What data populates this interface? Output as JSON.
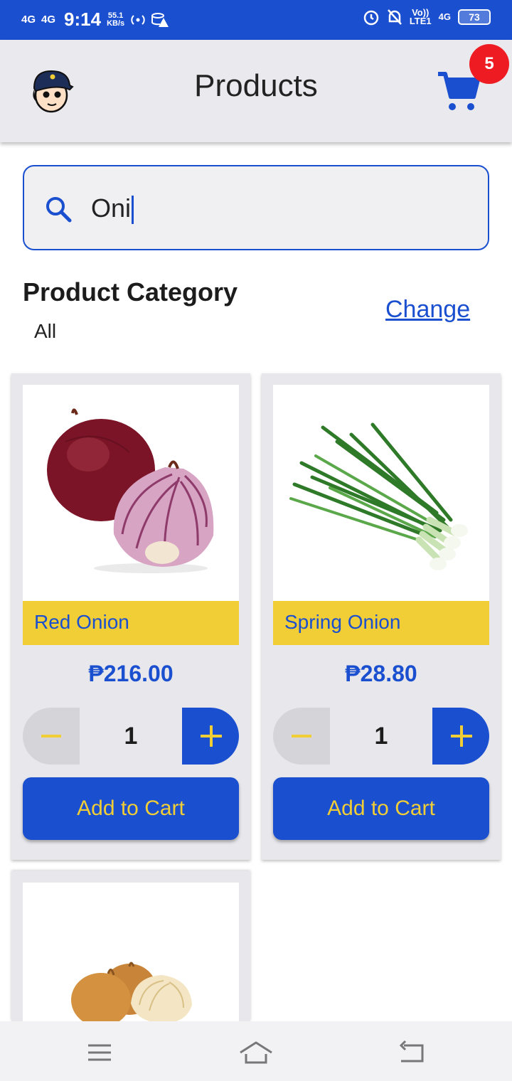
{
  "status_bar": {
    "signal_1": "4G",
    "signal_2": "4G",
    "time": "9:14",
    "speed_value": "55.1",
    "speed_unit": "KB/s",
    "volte": "Vo))",
    "lte": "LTE1",
    "net": "4G",
    "battery": "73"
  },
  "header": {
    "title": "Products",
    "cart_count": "5"
  },
  "search": {
    "value": "Oni",
    "placeholder": ""
  },
  "category": {
    "title": "Product Category",
    "value": "All",
    "change_label": "Change"
  },
  "products": [
    {
      "name": "Red Onion",
      "price": "₱216.00",
      "qty": "1",
      "add_label": "Add to Cart"
    },
    {
      "name": "Spring Onion",
      "price": "₱28.80",
      "qty": "1",
      "add_label": "Add to Cart"
    },
    {
      "name": "",
      "price": "",
      "qty": "",
      "add_label": ""
    }
  ],
  "colors": {
    "primary": "#1a4fd0",
    "accent": "#f1ce35",
    "badge": "#ee1b22"
  }
}
